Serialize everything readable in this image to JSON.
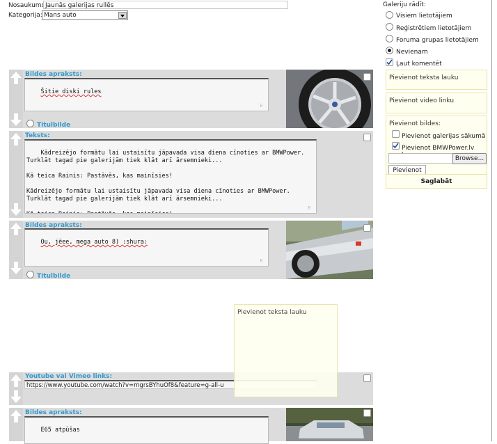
{
  "form": {
    "title_label": "Nosaukums:",
    "title_value": "Jaunās galerijas rullēs",
    "category_label": "Kategorija:",
    "category_value": "Mans auto"
  },
  "sidebar": {
    "gallery_show_label": "Galeriju rādīt:",
    "options": [
      {
        "label": "Visiem lietotājiem",
        "selected": false
      },
      {
        "label": "Reģistrētiem lietotājiem",
        "selected": false
      },
      {
        "label": "Foruma grupas lietotājiem",
        "selected": false
      },
      {
        "label": "Nevienam",
        "selected": true
      }
    ],
    "allow_comments": {
      "label": "Ļaut komentēt",
      "checked": true
    },
    "add_text_field": "Pievienot teksta lauku",
    "add_video_link": "Pievienot video linku",
    "add_images_label": "Pievienot bildes:",
    "add_to_gallery_start": {
      "label": "Pievienot galerijas sākumā",
      "checked": false
    },
    "add_bmw_logo": {
      "label": "Pievienot BMWPower.lv logo",
      "checked": true
    },
    "browse_button": "Browse...",
    "add_button": "Pievienot",
    "save_button": "Saglabāt"
  },
  "rows": [
    {
      "type": "image",
      "caption": "Bildes apraksts:",
      "text": "Šitie diski rules",
      "titul_label": "Titulbilde"
    },
    {
      "type": "text",
      "caption": "Teksts:",
      "text": "Kādreizējo formātu lai ustaisītu jāpavada visa diena cīnoties ar BMWPower. Turklāt tagad pie galerijām tiek klāt arī ārsemnieki...\n\nKā teica Rainis: Pastāvēs, kas mainīsies!\n\nKādreizējo formātu lai ustaisītu jāpavada visa diena cīnoties ar BMWPower. Turklāt tagad pie galerijām tiek klāt arī ārsemnieki...\n\nKā teica Rainis: Pastāvēs, kas mainīsies!"
    },
    {
      "type": "image",
      "caption": "Bildes apraksts:",
      "text": "Ou, jēee, mega auto 8) :shura:",
      "titul_label": "Titulbilde"
    },
    {
      "type": "video",
      "caption": "Youtube vai Vimeo links:",
      "text": "https://www.youtube.com/watch?v=mgrsBYhuOf8&feature=g-all-u"
    },
    {
      "type": "image",
      "caption": "Bildes apraksts:",
      "text": "E65 atpūšas"
    }
  ],
  "drag_ghost": {
    "label": "Pievienot teksta lauku"
  }
}
